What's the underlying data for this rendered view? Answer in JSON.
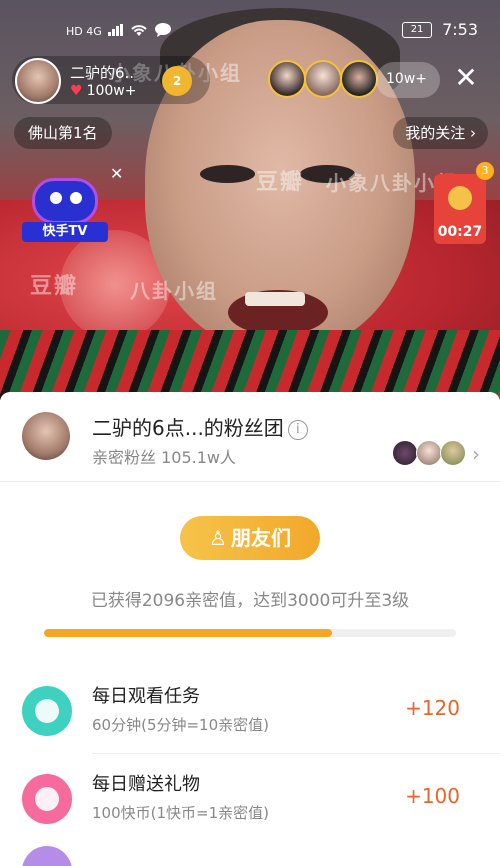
{
  "status_bar": {
    "left_indicators": "HD 4G",
    "battery": "21",
    "time": "7:53"
  },
  "host": {
    "name": "二驴的6..",
    "likes": "100w+",
    "badge": "2"
  },
  "viewers": {
    "count": "10w+"
  },
  "top_left_pill": "佛山第1名",
  "top_right_pill": "我的关注",
  "watermarks": [
    "豆瓣",
    "小象八卦小组",
    "豆瓣",
    "八卦小组"
  ],
  "ktv": {
    "label": "快手TV"
  },
  "red_packet": {
    "count": "3",
    "timer": "00:27"
  },
  "fan_club": {
    "title": "二驴的6点...的粉丝团",
    "fans_label": "亲密粉丝 105.1w人",
    "friends_button": "朋友们",
    "progress_text": "已获得2096亲密值，达到3000可升至3级",
    "progress_fraction": 0.6987
  },
  "tasks": [
    {
      "title": "每日观看任务",
      "subtitle": "60分钟(5分钟=10亲密值)",
      "reward": "+120",
      "color": "#3fd1c0"
    },
    {
      "title": "每日赠送礼物",
      "subtitle": "100快币(1快币=1亲密值)",
      "reward": "+100",
      "color": "#f76a9c"
    }
  ],
  "colors": {
    "accent_orange": "#f5a623",
    "reward_orange": "#e8652a",
    "heart_red": "#ff3b50"
  },
  "icons": [
    "signal-icon",
    "wifi-icon",
    "message-icon",
    "heart-icon",
    "close-icon",
    "chevron-right-icon",
    "info-icon",
    "clock-icon",
    "gift-icon",
    "friends-icon"
  ]
}
